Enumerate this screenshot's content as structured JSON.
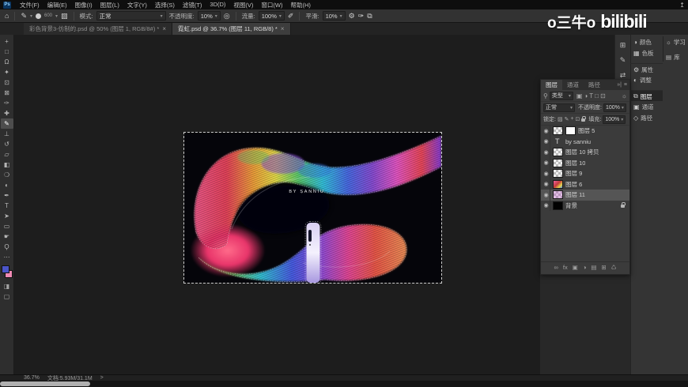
{
  "watermark": {
    "name": "o三牛o",
    "brand": "bilibili"
  },
  "window": {
    "share_icon": "↥",
    "min_icon": "–"
  },
  "menu_bar": {
    "logo": "Ps",
    "items": [
      "文件(F)",
      "编辑(E)",
      "图像(I)",
      "图层(L)",
      "文字(Y)",
      "选择(S)",
      "滤镜(T)",
      "3D(D)",
      "视图(V)",
      "窗口(W)",
      "帮助(H)"
    ]
  },
  "options_bar": {
    "home_icon": "⌂",
    "brush_icon": "✎",
    "brush_size": "600",
    "toggle_icon": "▨",
    "mode_label": "模式:",
    "mode_value": "正常",
    "opacity_label": "不透明度:",
    "opacity_value": "10%",
    "airbrush_icon": "◎",
    "flow_label": "流量:",
    "flow_value": "100%",
    "flow_airbrush_icon": "✐",
    "smooth_label": "平滑:",
    "smooth_value": "10%",
    "gear_icon": "⚙",
    "pressure_icon": "✑",
    "sym_icon": "⧉",
    "dropdown_glyph": "▾"
  },
  "doc_tabs": [
    {
      "title": "彩色背景3-仿制的.psd @ 50% (图层 1, RGB/8#) *",
      "active": false
    },
    {
      "title": "霓虹.psd @ 36.7% (图层 11, RGB/8) *",
      "active": true
    }
  ],
  "tab_close_glyph": "×",
  "toolbar": {
    "tools": [
      {
        "name": "move-tool",
        "glyph": "+"
      },
      {
        "name": "marquee-tool",
        "glyph": "□"
      },
      {
        "name": "lasso-tool",
        "glyph": "Ω"
      },
      {
        "name": "quick-selection-tool",
        "glyph": "✦"
      },
      {
        "name": "crop-tool",
        "glyph": "⊡"
      },
      {
        "name": "frame-tool",
        "glyph": "⊠"
      },
      {
        "name": "eyedropper-tool",
        "glyph": "✑"
      },
      {
        "name": "healing-brush-tool",
        "glyph": "✚"
      },
      {
        "name": "brush-tool",
        "glyph": "✎",
        "active": true
      },
      {
        "name": "clone-stamp-tool",
        "glyph": "⊥"
      },
      {
        "name": "history-brush-tool",
        "glyph": "↺"
      },
      {
        "name": "eraser-tool",
        "glyph": "▱"
      },
      {
        "name": "gradient-tool",
        "glyph": "◧"
      },
      {
        "name": "blur-tool",
        "glyph": "❍"
      },
      {
        "name": "dodge-tool",
        "glyph": "◐"
      },
      {
        "name": "pen-tool",
        "glyph": "✒"
      },
      {
        "name": "type-tool",
        "glyph": "T"
      },
      {
        "name": "path-selection-tool",
        "glyph": "➤"
      },
      {
        "name": "rectangle-tool",
        "glyph": "▭"
      },
      {
        "name": "hand-tool",
        "glyph": "☛"
      },
      {
        "name": "zoom-tool",
        "glyph": "Ϙ"
      }
    ],
    "more_icon": "⋯",
    "fg_color": "#4b55c8",
    "bg_color": "#f08ab4",
    "quick_mask_icon": "◨",
    "screen_mode_icon": "▢"
  },
  "canvas": {
    "signature": "BY ṢANNIU"
  },
  "right_dock": {
    "mini_icons": [
      {
        "name": "collapse-panels-icon",
        "glyph": "⊞"
      },
      {
        "name": "brush-settings-icon",
        "glyph": "✎"
      },
      {
        "name": "swap-icon",
        "glyph": "⇄"
      }
    ],
    "panels": [
      {
        "label": "颜色",
        "glyph": "◑"
      },
      {
        "label": "色板",
        "glyph": "▦"
      },
      {
        "label": "属性",
        "glyph": "⚙",
        "gap": true
      },
      {
        "label": "调整",
        "glyph": "◐"
      },
      {
        "label": "图层",
        "glyph": "⧉",
        "active": true,
        "gap": true
      },
      {
        "label": "通道",
        "glyph": "▣"
      },
      {
        "label": "路径",
        "glyph": "◇"
      }
    ],
    "far": [
      {
        "label": "学习",
        "glyph": "☼"
      },
      {
        "label": "库",
        "glyph": "▤"
      }
    ]
  },
  "layers_panel": {
    "tabs": [
      {
        "label": "图层",
        "active": true
      },
      {
        "label": "通道"
      },
      {
        "label": "路径"
      }
    ],
    "header_icons": {
      "collapse": "»|",
      "menu": "≡"
    },
    "filter": {
      "search_icon": "⚲",
      "kind_value": "类型",
      "icons": [
        "▣",
        "◑",
        "T",
        "□",
        "⊡"
      ],
      "bulb_icon": "☼"
    },
    "blend": {
      "mode_value": "正常",
      "opacity_label": "不透明度:",
      "opacity_value": "100%"
    },
    "lock": {
      "label": "锁定:",
      "icons": [
        "▨",
        "✎",
        "+",
        "⊡"
      ],
      "fill_label": "填充:",
      "fill_value": "100%"
    },
    "eye_glyph": "◉",
    "layers": [
      {
        "name": "图层 5",
        "thumb": "checker",
        "mask": true
      },
      {
        "name": "by sanniu",
        "thumb": "text"
      },
      {
        "name": "图层 10 拷贝",
        "thumb": "checker"
      },
      {
        "name": "图层 10",
        "thumb": "checker"
      },
      {
        "name": "图层 9",
        "thumb": "checker"
      },
      {
        "name": "图层 6",
        "thumb": "art"
      },
      {
        "name": "图层 11",
        "thumb": "checkerart",
        "selected": true
      },
      {
        "name": "背景",
        "thumb": "black",
        "locked": true
      }
    ],
    "footer_icons": [
      {
        "name": "link-icon",
        "glyph": "∞"
      },
      {
        "name": "fx-icon",
        "glyph": "fx"
      },
      {
        "name": "layer-mask-icon",
        "glyph": "▣"
      },
      {
        "name": "adjustment-layer-icon",
        "glyph": "◑"
      },
      {
        "name": "group-icon",
        "glyph": "▤"
      },
      {
        "name": "new-layer-icon",
        "glyph": "⊞"
      },
      {
        "name": "trash-icon",
        "glyph": "♺"
      }
    ]
  },
  "status_bar": {
    "zoom": "36.7%",
    "doc_info": "文档:5.93M/31.1M",
    "chevron": ">"
  }
}
